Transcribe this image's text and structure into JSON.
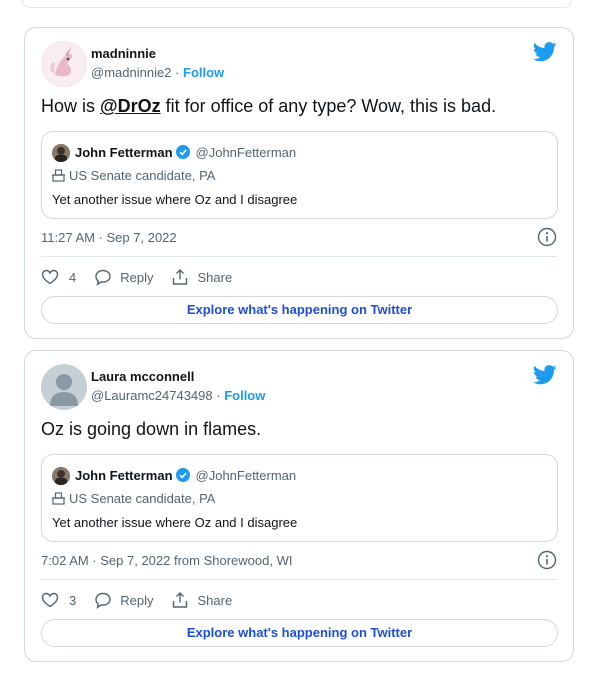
{
  "tweets": [
    {
      "name": "madninnie",
      "handle": "@madninnie2",
      "follow_label": "Follow",
      "text_before": "How is ",
      "mention": "@DrOz",
      "text_after": " fit for office of any type? Wow, this is bad.",
      "quote": {
        "name": "John Fetterman",
        "handle": "@JohnFetterman",
        "description": "US Senate candidate, PA",
        "text": "Yet another issue where Oz and I disagree"
      },
      "timestamp": "11:27 AM · Sep 7, 2022",
      "likes": "4",
      "reply_label": "Reply",
      "share_label": "Share",
      "explore_label": "Explore what's happening on Twitter"
    },
    {
      "name": "Laura mcconnell",
      "handle": "@Lauramc24743498",
      "follow_label": "Follow",
      "text": "Oz is going down in flames.",
      "quote": {
        "name": "John Fetterman",
        "handle": "@JohnFetterman",
        "description": "US Senate candidate, PA",
        "text": "Yet another issue where Oz and I disagree"
      },
      "timestamp": "7:02 AM · Sep 7, 2022 from Shorewood, WI",
      "likes": "3",
      "reply_label": "Reply",
      "share_label": "Share",
      "explore_label": "Explore what's happening on Twitter"
    }
  ],
  "colors": {
    "accent": "#1d9bf0",
    "text_primary": "#0f1419",
    "text_secondary": "#536471",
    "border": "#cfd9de"
  },
  "icons": {
    "brand": "twitter-bird-icon",
    "verified": "verified-badge-icon",
    "ballot": "ballot-box-icon",
    "info": "info-icon",
    "like": "heart-icon",
    "reply": "speech-bubble-icon",
    "share": "share-icon"
  }
}
